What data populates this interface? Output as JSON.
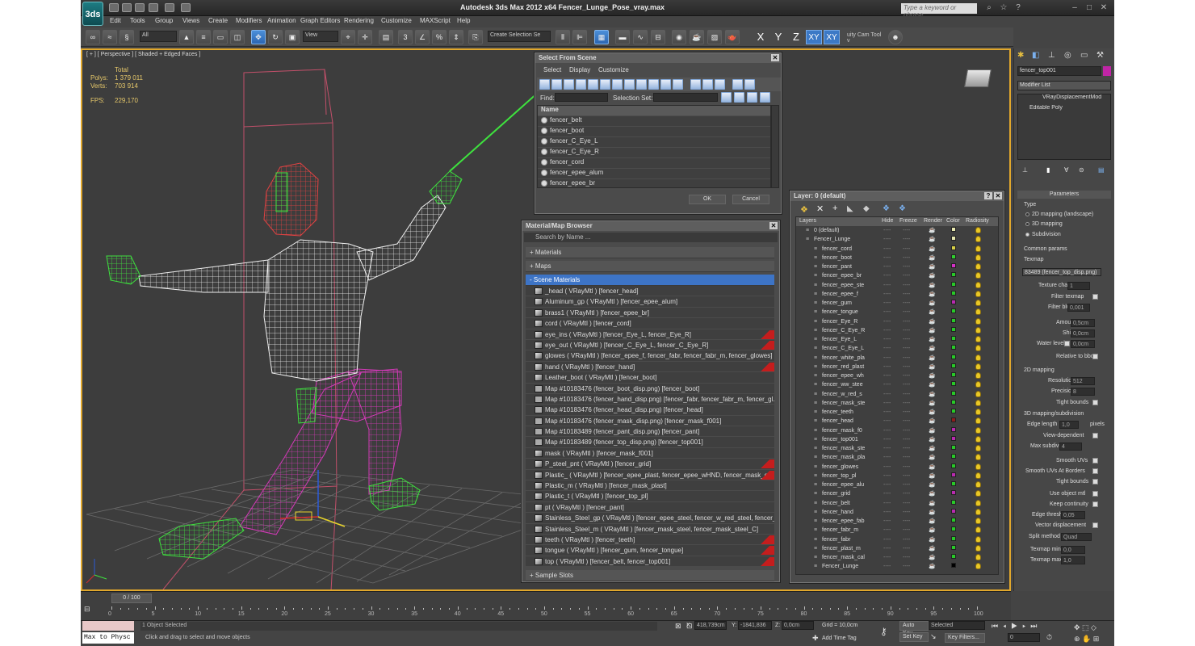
{
  "app": {
    "title": "Autodesk 3ds Max  2012 x64     Fencer_Lunge_Pose_vray.max",
    "search_placeholder": "Type a keyword or phrase",
    "logo": "3ds"
  },
  "menu": [
    "Edit",
    "Tools",
    "Group",
    "Views",
    "Create",
    "Modifiers",
    "Animation",
    "Graph Editors",
    "Rendering",
    "Customize",
    "MAXScript",
    "Help"
  ],
  "toolbar": {
    "filter": "All",
    "view": "View",
    "selection_set": "Create Selection Se",
    "axes": [
      "X",
      "Y",
      "Z",
      "XY",
      "XY"
    ],
    "camera_tool": "uity Cam Tool v"
  },
  "viewport": {
    "label": "[ + ] [ Perspective ] [ Shaded + Edged Faces ]",
    "stats": {
      "header": "Total",
      "polys_label": "Polys:",
      "polys": "1 379 011",
      "verts_label": "Verts:",
      "verts": "703 914",
      "fps_label": "FPS:",
      "fps": "229,170"
    }
  },
  "select_dialog": {
    "title": "Select From Scene",
    "menus": [
      "Select",
      "Display",
      "Customize"
    ],
    "find_label": "Find:",
    "selection_set_label": "Selection Set:",
    "column": "Name",
    "items": [
      "fencer_belt",
      "fencer_boot",
      "fencer_C_Eye_L",
      "fencer_C_Eye_R",
      "fencer_cord",
      "fencer_epee_alum",
      "fencer_epee_br"
    ],
    "ok": "OK",
    "cancel": "Cancel"
  },
  "material_browser": {
    "title": "Material/Map Browser",
    "search": "Search by Name ...",
    "sections": [
      "+ Materials",
      "+ Maps",
      "- Scene Materials",
      "+ Sample Slots"
    ],
    "items": [
      {
        "text": "_head  ( VRayMtl ) [fencer_head]",
        "red": false,
        "map": false
      },
      {
        "text": "Aluminum_gp  ( VRayMtl ) [fencer_epee_alum]",
        "red": false,
        "map": false
      },
      {
        "text": "brass1  ( VRayMtl ) [fencer_epee_br]",
        "red": false,
        "map": false
      },
      {
        "text": "cord  ( VRayMtl ) [fencer_cord]",
        "red": false,
        "map": false
      },
      {
        "text": "eye_ins  ( VRayMtl ) [fencer_Eye_L, fencer_Eye_R]",
        "red": true,
        "map": false
      },
      {
        "text": "eye_out  ( VRayMtl ) [fencer_C_Eye_L, fencer_C_Eye_R]",
        "red": true,
        "map": false
      },
      {
        "text": "glowes  ( VRayMtl ) [fencer_epee_f, fencer_fabr, fencer_fabr_m, fencer_glowes]",
        "red": false,
        "map": false
      },
      {
        "text": "hand  ( VRayMtl ) [fencer_hand]",
        "red": true,
        "map": false
      },
      {
        "text": "Leather_boot  ( VRayMtl ) [fencer_boot]",
        "red": false,
        "map": false
      },
      {
        "text": "Map #10183476 (fencer_boot_disp.png) [fencer_boot]",
        "red": false,
        "map": true
      },
      {
        "text": "Map #10183476 (fencer_hand_disp.png) [fencer_fabr, fencer_fabr_m, fencer_gl...",
        "red": false,
        "map": true
      },
      {
        "text": "Map #10183476 (fencer_head_disp.png) [fencer_head]",
        "red": false,
        "map": true
      },
      {
        "text": "Map #10183476 (fencer_mask_disp.png) [fencer_mask_f001]",
        "red": false,
        "map": true
      },
      {
        "text": "Map #10183489 (fencer_pant_disp.png) [fencer_pant]",
        "red": false,
        "map": true
      },
      {
        "text": "Map #10183489 (fencer_top_disp.png) [fencer_top001]",
        "red": false,
        "map": true
      },
      {
        "text": "mask  ( VRayMtl ) [fencer_mask_f001]",
        "red": false,
        "map": false
      },
      {
        "text": "P_steel_pnt  ( VRayMtl ) [fencer_grid]",
        "red": true,
        "map": false
      },
      {
        "text": "Plastic_  ( VRayMtl ) [fencer_epee_plast, fencer_epee_wHND, fencer_mask_cabl...",
        "red": true,
        "map": false
      },
      {
        "text": "Plastic_m  ( VRayMtl ) [fencer_mask_plast]",
        "red": false,
        "map": false
      },
      {
        "text": "Plastic_t  ( VRayMtl ) [fencer_top_pl]",
        "red": false,
        "map": false
      },
      {
        "text": "pt  ( VRayMtl ) [fencer_pant]",
        "red": false,
        "map": false
      },
      {
        "text": "Stainless_Steel_gp  ( VRayMtl ) [fencer_epee_steel, fencer_w_red_steel, fencer_...",
        "red": false,
        "map": false
      },
      {
        "text": "Stainless_Steel_m  ( VRayMtl ) [fencer_mask_steel, fencer_mask_steel_C]",
        "red": false,
        "map": false
      },
      {
        "text": "teeth  ( VRayMtl ) [fencer_teeth]",
        "red": true,
        "map": false
      },
      {
        "text": "tongue  ( VRayMtl ) [fencer_gum, fencer_tongue]",
        "red": true,
        "map": false
      },
      {
        "text": "top  ( VRayMtl ) [fencer_belt, fencer_top001]",
        "red": true,
        "map": false
      }
    ]
  },
  "layer_dialog": {
    "title": "Layer: 0 (default)",
    "columns": [
      "Layers",
      "Hide",
      "Freeze",
      "Render",
      "Color",
      "Radiosity"
    ],
    "hide_mark": "----",
    "rows": [
      {
        "name": "0 (default)",
        "color": "#e8e8b0",
        "level": 0
      },
      {
        "name": "Fencer_Lunge",
        "color": "#e8e8b0",
        "level": 0
      },
      {
        "name": "fencer_cord",
        "color": "#d8d047",
        "level": 1
      },
      {
        "name": "fencer_boot",
        "color": "#30d02f",
        "level": 1
      },
      {
        "name": "fencer_pant",
        "color": "#d630c8",
        "level": 1
      },
      {
        "name": "fencer_epee_br",
        "color": "#28c928",
        "level": 1
      },
      {
        "name": "fencer_epee_ste",
        "color": "#28c928",
        "level": 1
      },
      {
        "name": "fencer_epee_f",
        "color": "#28c928",
        "level": 1
      },
      {
        "name": "fencer_gum",
        "color": "#b92ab0",
        "level": 1
      },
      {
        "name": "fencer_tongue",
        "color": "#28c928",
        "level": 1
      },
      {
        "name": "fencer_Eye_R",
        "color": "#28c928",
        "level": 1
      },
      {
        "name": "fencer_C_Eye_R",
        "color": "#28c928",
        "level": 1
      },
      {
        "name": "fencer_Eye_L",
        "color": "#28c928",
        "level": 1
      },
      {
        "name": "fencer_C_Eye_L",
        "color": "#28c928",
        "level": 1
      },
      {
        "name": "fencer_white_pla",
        "color": "#28c928",
        "level": 1
      },
      {
        "name": "fencer_red_plast",
        "color": "#28c928",
        "level": 1
      },
      {
        "name": "fencer_epee_wh",
        "color": "#28c928",
        "level": 1
      },
      {
        "name": "fencer_ww_stee",
        "color": "#28c928",
        "level": 1
      },
      {
        "name": "fencer_w_red_s",
        "color": "#28c928",
        "level": 1
      },
      {
        "name": "fencer_mask_ste",
        "color": "#28c928",
        "level": 1
      },
      {
        "name": "fencer_teeth",
        "color": "#28c928",
        "level": 1
      },
      {
        "name": "fencer_head",
        "color": "#8e1d1d",
        "level": 1
      },
      {
        "name": "fencer_mask_f0",
        "color": "#b92ab0",
        "level": 1
      },
      {
        "name": "fencer_top001",
        "color": "#b92ab0",
        "level": 1
      },
      {
        "name": "fencer_mask_ste",
        "color": "#28c928",
        "level": 1
      },
      {
        "name": "fencer_mask_pla",
        "color": "#28c928",
        "level": 1
      },
      {
        "name": "fencer_glowes",
        "color": "#28c928",
        "level": 1
      },
      {
        "name": "fencer_top_pl",
        "color": "#b92ab0",
        "level": 1
      },
      {
        "name": "fencer_epee_alu",
        "color": "#28c928",
        "level": 1
      },
      {
        "name": "fencer_grid",
        "color": "#b92ab0",
        "level": 1
      },
      {
        "name": "fencer_belt",
        "color": "#28c928",
        "level": 1
      },
      {
        "name": "fencer_hand",
        "color": "#b92ab0",
        "level": 1
      },
      {
        "name": "fencer_epee_fab",
        "color": "#28c928",
        "level": 1
      },
      {
        "name": "fencer_fabr_m",
        "color": "#28c928",
        "level": 1
      },
      {
        "name": "fencer_fabr",
        "color": "#28c928",
        "level": 1
      },
      {
        "name": "fencer_plast_m",
        "color": "#28c928",
        "level": 1
      },
      {
        "name": "fencer_mask_cal",
        "color": "#28c928",
        "level": 1
      },
      {
        "name": "Fencer_Lunge",
        "color": "#000000",
        "level": 1
      }
    ]
  },
  "command_panel": {
    "object_name": "fencer_top001",
    "modifier_list": "Modifier List",
    "stack": [
      "VRayDisplacementMod",
      "Editable Poly"
    ],
    "parameters": "Parameters",
    "type_label": "Type",
    "type_options": [
      "2D mapping (landscape)",
      "3D mapping",
      "Subdivision"
    ],
    "common_params": "Common params",
    "texmap_label": "Texmap",
    "texmap_value": "83489 (fencer_top_disp.png)",
    "texture_chan_label": "Texture chan",
    "texture_chan": "1",
    "filter_texmap": "Filter texmap",
    "filter_blur_label": "Filter blur",
    "filter_blur": "0,001",
    "amount_label": "Amount",
    "amount": "0,5cm",
    "shift_label": "Shift",
    "shift": "0,0cm",
    "water_level_label": "Water level",
    "water_level": "0,0cm",
    "relative_bbox": "Relative to bbox",
    "mapping2d": "2D mapping",
    "resolution_label": "Resolution",
    "resolution": "512",
    "precision_label": "Precision",
    "precision": "8",
    "tight_bounds": "Tight bounds",
    "subdiv_section": "3D mapping/subdivision",
    "edge_length_label": "Edge length",
    "edge_length": "1,0",
    "pixels": "pixels",
    "view_dependent": "View-dependent",
    "max_subdivs_label": "Max subdivs",
    "max_subdivs": "4",
    "smooth_uvs": "Smooth UVs",
    "smooth_uvs_borders": "Smooth UVs At Borders",
    "tight_bounds2": "Tight bounds",
    "use_object_mtl": "Use object mtl",
    "keep_continuity": "Keep continuity",
    "edge_thresh_label": "Edge thresh",
    "edge_thresh": "0,05",
    "vector_disp": "Vector displacement",
    "split_method_label": "Split method",
    "split_method": "Quad",
    "texmap_min_label": "Texmap min:",
    "texmap_min": "0,0",
    "texmap_max_label": "Texmap max:",
    "texmap_max": "1,0"
  },
  "timeline": {
    "frame": "0 / 100",
    "ticks": [
      "0",
      "5",
      "10",
      "15",
      "20",
      "25",
      "30",
      "35",
      "40",
      "45",
      "50",
      "55",
      "60",
      "65",
      "70",
      "75",
      "80",
      "85",
      "90",
      "95",
      "100"
    ]
  },
  "status": {
    "script": "Max to Physc",
    "selected": "1 Object Selected",
    "prompt": "Click and drag to select and move objects",
    "x_label": "X:",
    "x": "418,739cm",
    "y_label": "Y:",
    "y": "-1841,836",
    "z_label": "Z:",
    "z": "0,0cm",
    "grid": "Grid = 10,0cm",
    "add_time_tag": "Add Time Tag",
    "auto_key": "Auto Key",
    "set_key": "Set Key",
    "selected_dd": "Selected",
    "key_filters": "Key Filters...",
    "frame": "0"
  },
  "colors": {
    "viewport_border": "#e0a72c",
    "selection_blue": "#3d74c6",
    "wire_white": "#f0f0f0",
    "wire_pink": "#d33ab8",
    "wire_green": "#3ee23e",
    "wire_red": "#e04242"
  }
}
